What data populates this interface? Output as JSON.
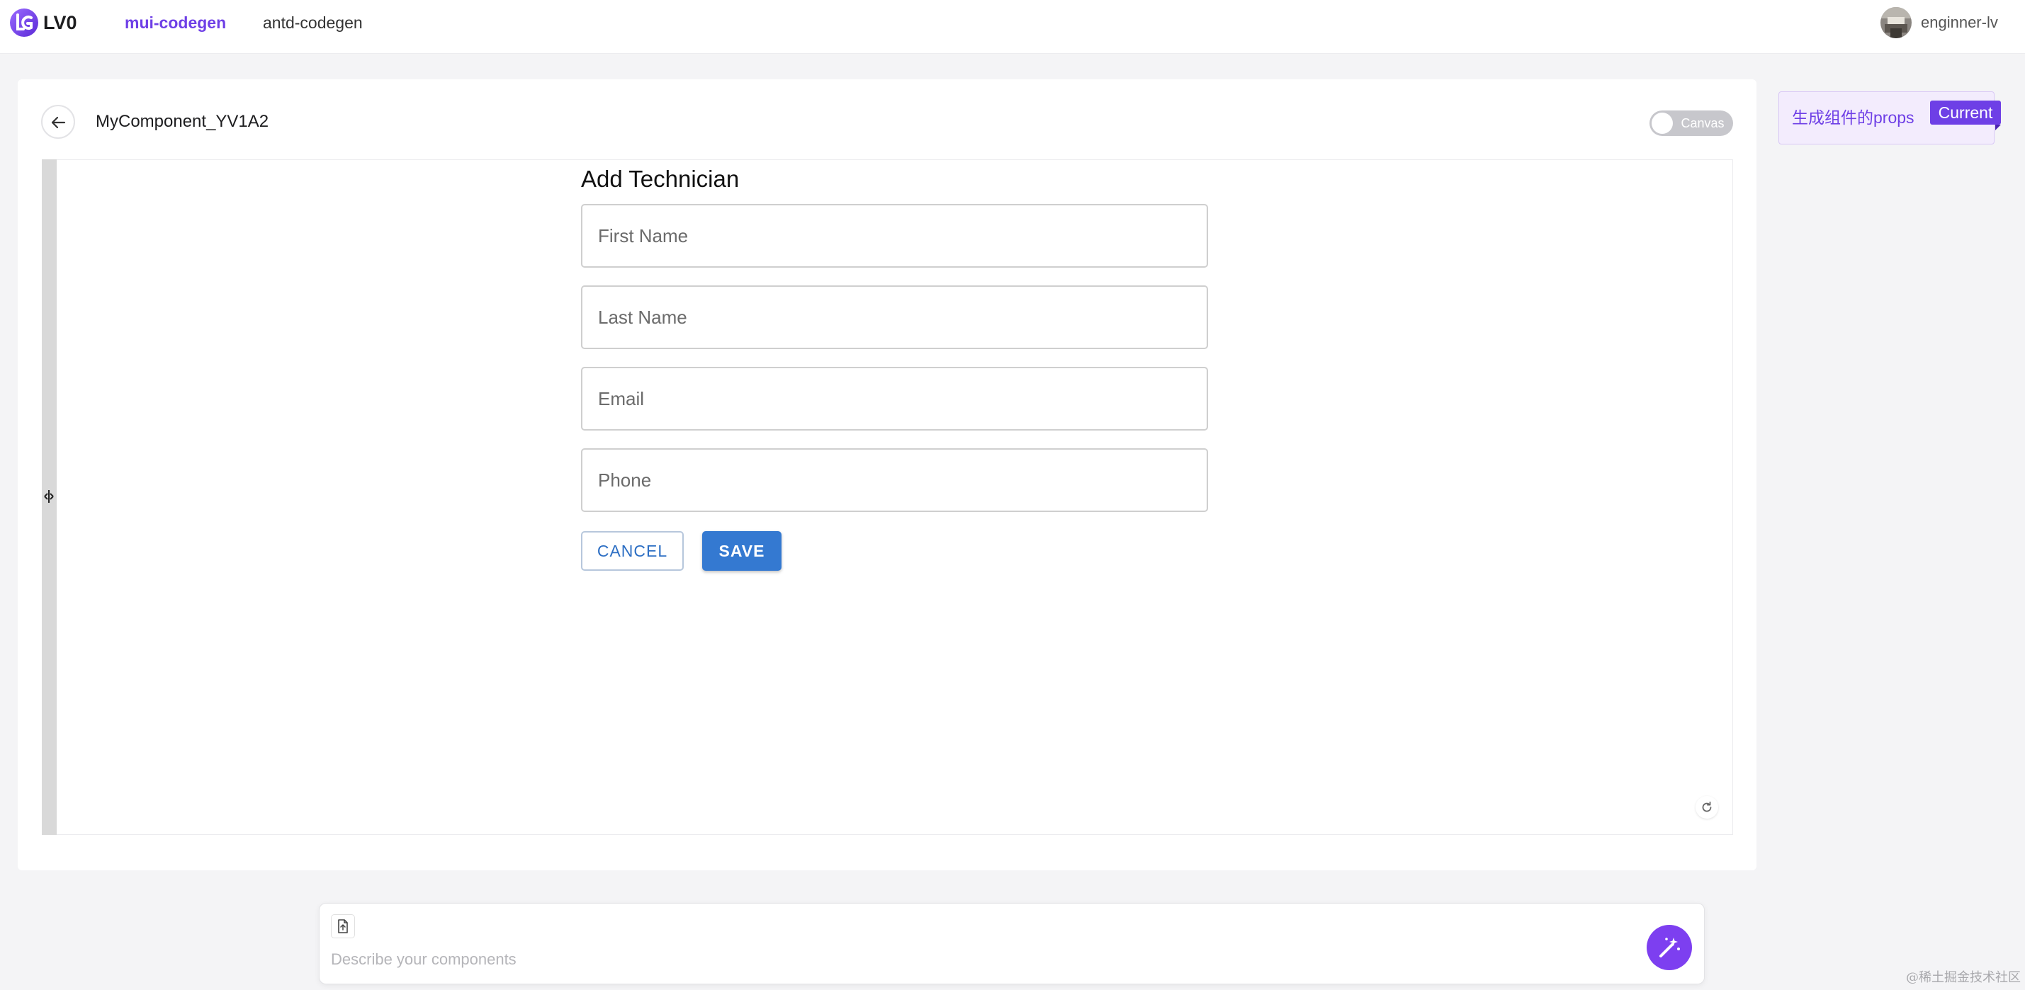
{
  "header": {
    "brand": "LV0",
    "nav": [
      {
        "label": "mui-codegen",
        "active": true
      },
      {
        "label": "antd-codegen",
        "active": false
      }
    ],
    "user": {
      "name": "enginner-lv"
    }
  },
  "main": {
    "component_name": "MyComponent_YV1A2",
    "canvas_toggle_label": "Canvas",
    "canvas_toggle_on": false
  },
  "preview": {
    "title": "Add Technician",
    "fields": [
      {
        "label": "First Name"
      },
      {
        "label": "Last Name"
      },
      {
        "label": "Email"
      },
      {
        "label": "Phone"
      }
    ],
    "cancel_label": "CANCEL",
    "save_label": "SAVE"
  },
  "history": {
    "items": [
      {
        "label": "生成组件的props",
        "badge": "Current"
      }
    ]
  },
  "prompt": {
    "placeholder": "Describe your components",
    "value": ""
  },
  "watermark": "@稀土掘金技术社区",
  "colors": {
    "accent": "#6e3fe6",
    "primary_button": "#3479d1",
    "generate_button": "#7d3ff0"
  }
}
